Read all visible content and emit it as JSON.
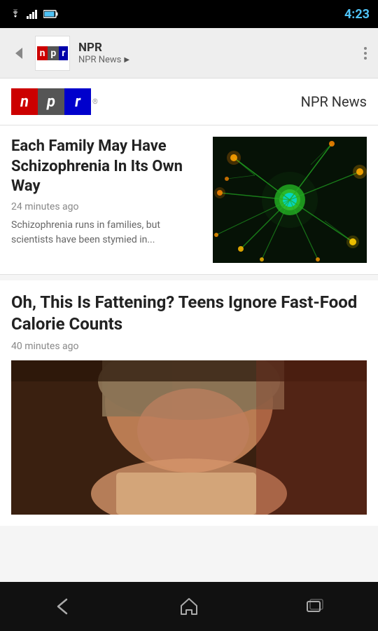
{
  "statusBar": {
    "time": "4:23",
    "wifiIcon": "wifi",
    "signalIcon": "signal",
    "batteryIcon": "battery"
  },
  "appBar": {
    "title": "NPR",
    "subtitle": "NPR News",
    "backLabel": "◀",
    "overflowLabel": "⋮"
  },
  "header": {
    "logoN": "n",
    "logoP": "p",
    "logoR": "r",
    "trademark": "®",
    "brandLabel": "NPR News"
  },
  "articles": [
    {
      "title": "Each Family May Have Schizophrenia In Its Own Way",
      "time": "24 minutes ago",
      "description": "Schizophrenia runs in families, but scientists have been stymied in...",
      "hasImage": true,
      "imageAlt": "neuron-science-image"
    },
    {
      "title": "Oh, This Is Fattening? Teens Ignore Fast-Food Calorie Counts",
      "time": "40 minutes ago",
      "description": "",
      "hasImage": true,
      "imageAlt": "teen-eating-image"
    }
  ],
  "bottomNav": {
    "backLabel": "←",
    "homeLabel": "⌂",
    "recentLabel": "▭"
  }
}
